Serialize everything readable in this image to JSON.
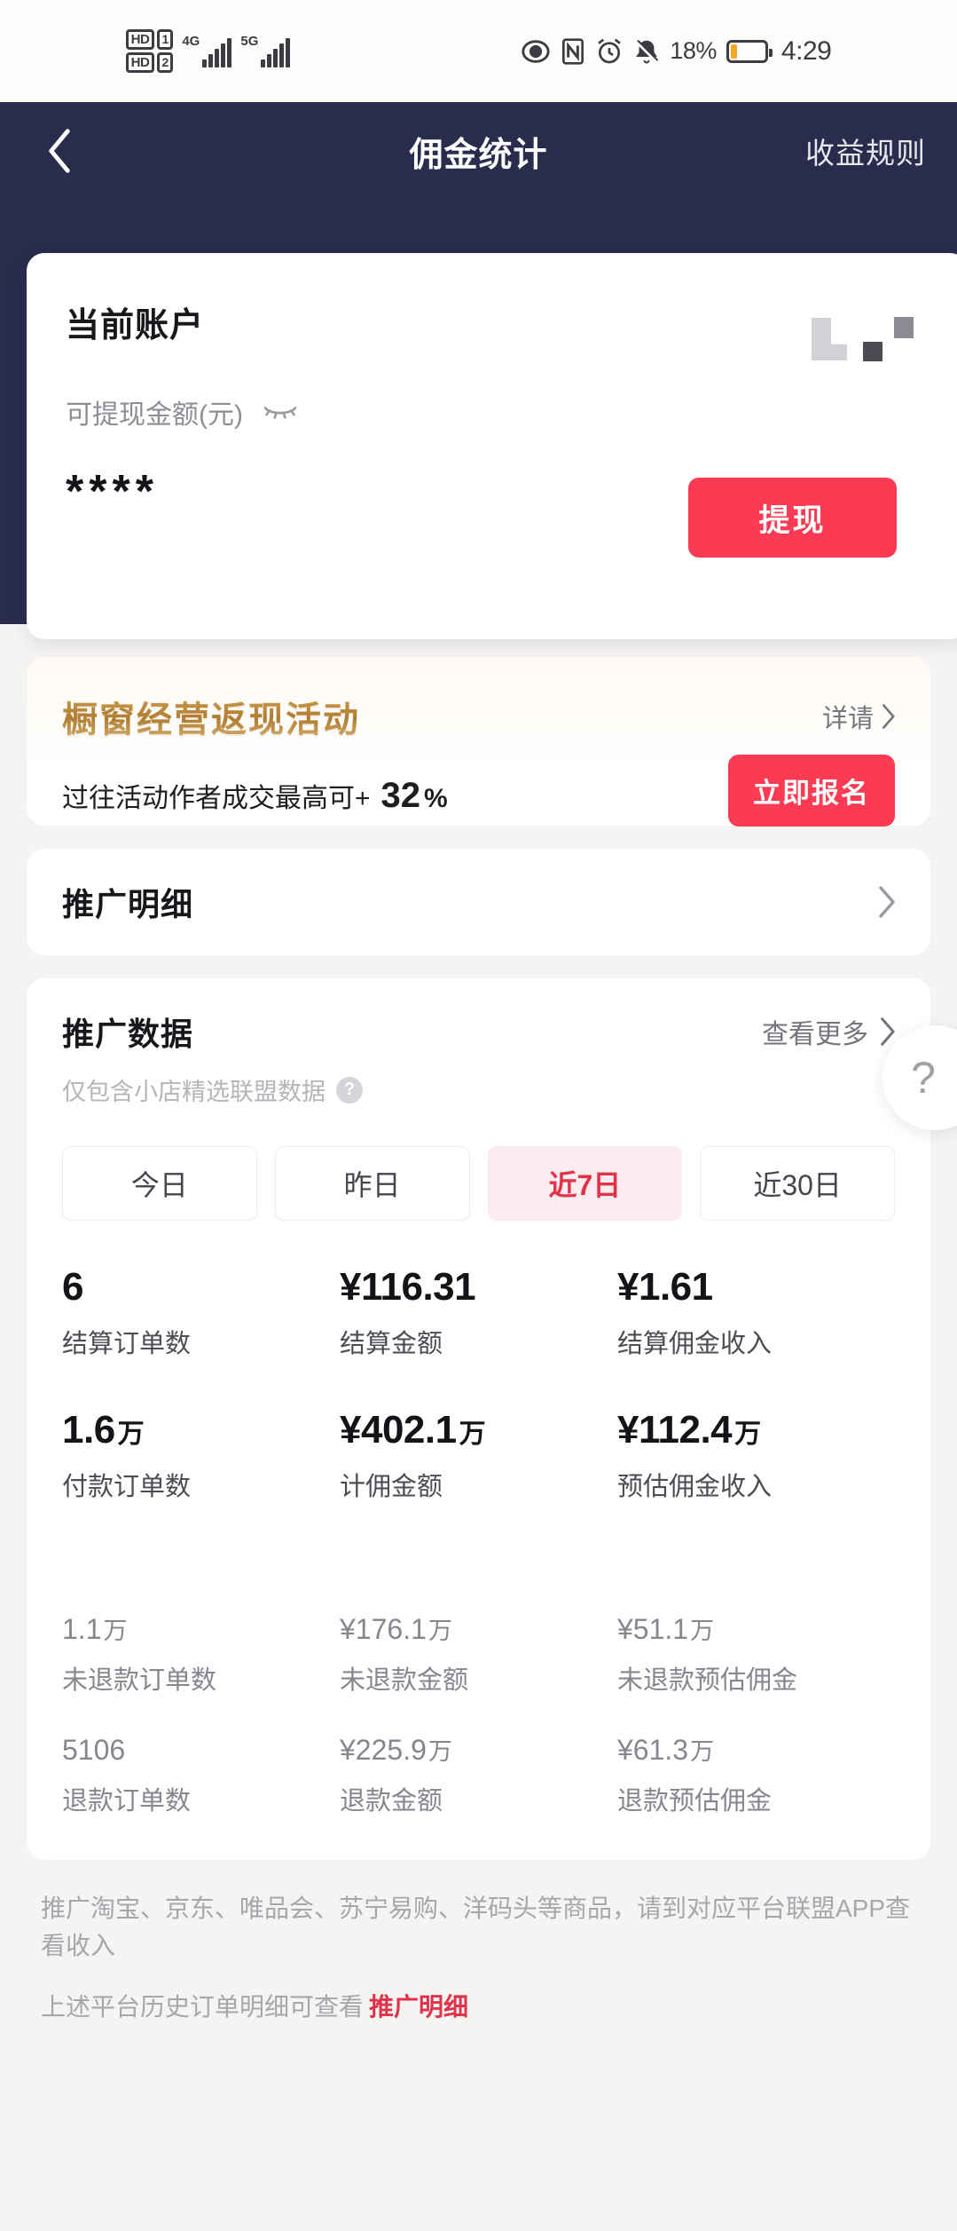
{
  "status_bar": {
    "hd1_label": "HD",
    "sim1_label": "1",
    "hd2_label": "HD",
    "sim2_label": "2",
    "network1": "4G",
    "network2": "5G",
    "battery_percent": "18%",
    "clock": "4:29",
    "icons": [
      "eye-icon",
      "nfc-icon",
      "alarm-icon",
      "mute-bell-icon",
      "battery-icon"
    ]
  },
  "header": {
    "back_icon": "chevron-left-icon",
    "title": "佣金统计",
    "action_label": "收益规则",
    "background_color": "#2a2c4e"
  },
  "account_card": {
    "title": "当前账户",
    "balance_label": "可提现金额(元)",
    "visibility_icon": "eye-off-icon",
    "balance_value": "****",
    "withdraw_button": "提现",
    "withdraw_button_color": "#fa3b53"
  },
  "promo": {
    "title": "橱窗经营返现活动",
    "detail_link": "详请",
    "detail_chevron": "chevron-right-icon",
    "description": "过往活动作者成交最高可+",
    "percent_value": "32",
    "percent_sign": "%",
    "cta_button": "立即报名",
    "cta_color": "#fa3b53"
  },
  "promotion_detail_row": {
    "title": "推广明细",
    "chevron": "chevron-right-icon"
  },
  "promotion_data": {
    "title": "推广数据",
    "more_label": "查看更多",
    "more_chevron": "chevron-right-icon",
    "subtitle": "仅包含小店精选联盟数据",
    "help_icon": "question-mark-icon",
    "tabs": [
      {
        "label": "今日",
        "active": false
      },
      {
        "label": "昨日",
        "active": false
      },
      {
        "label": "近7日",
        "active": true
      },
      {
        "label": "近30日",
        "active": false
      }
    ],
    "primary_stats": [
      {
        "value": "6",
        "unit": "",
        "label": "结算订单数"
      },
      {
        "value": "¥116.31",
        "unit": "",
        "label": "结算金额"
      },
      {
        "value": "¥1.61",
        "unit": "",
        "label": "结算佣金收入"
      },
      {
        "value": "1.6",
        "unit": "万",
        "label": "付款订单数"
      },
      {
        "value": "¥402.1",
        "unit": "万",
        "label": "计佣金额"
      },
      {
        "value": "¥112.4",
        "unit": "万",
        "label": "预估佣金收入"
      }
    ],
    "secondary_stats": [
      {
        "value": "1.1",
        "unit": "万",
        "label": "未退款订单数"
      },
      {
        "value": "¥176.1",
        "unit": "万",
        "label": "未退款金额"
      },
      {
        "value": "¥51.1",
        "unit": "万",
        "label": "未退款预估佣金"
      },
      {
        "value": "5106",
        "unit": "",
        "label": "退款订单数"
      },
      {
        "value": "¥225.9",
        "unit": "万",
        "label": "退款金额"
      },
      {
        "value": "¥61.3",
        "unit": "万",
        "label": "退款预估佣金"
      }
    ]
  },
  "footer": {
    "line1": "推广淘宝、京东、唯品会、苏宁易购、洋码头等商品，请到对应平台联盟APP查看收入",
    "line2_prefix": "上述平台历史订单明细可查看",
    "line2_link": "推广明细"
  },
  "floating_help": {
    "icon": "question-mark-icon",
    "label": "?"
  }
}
